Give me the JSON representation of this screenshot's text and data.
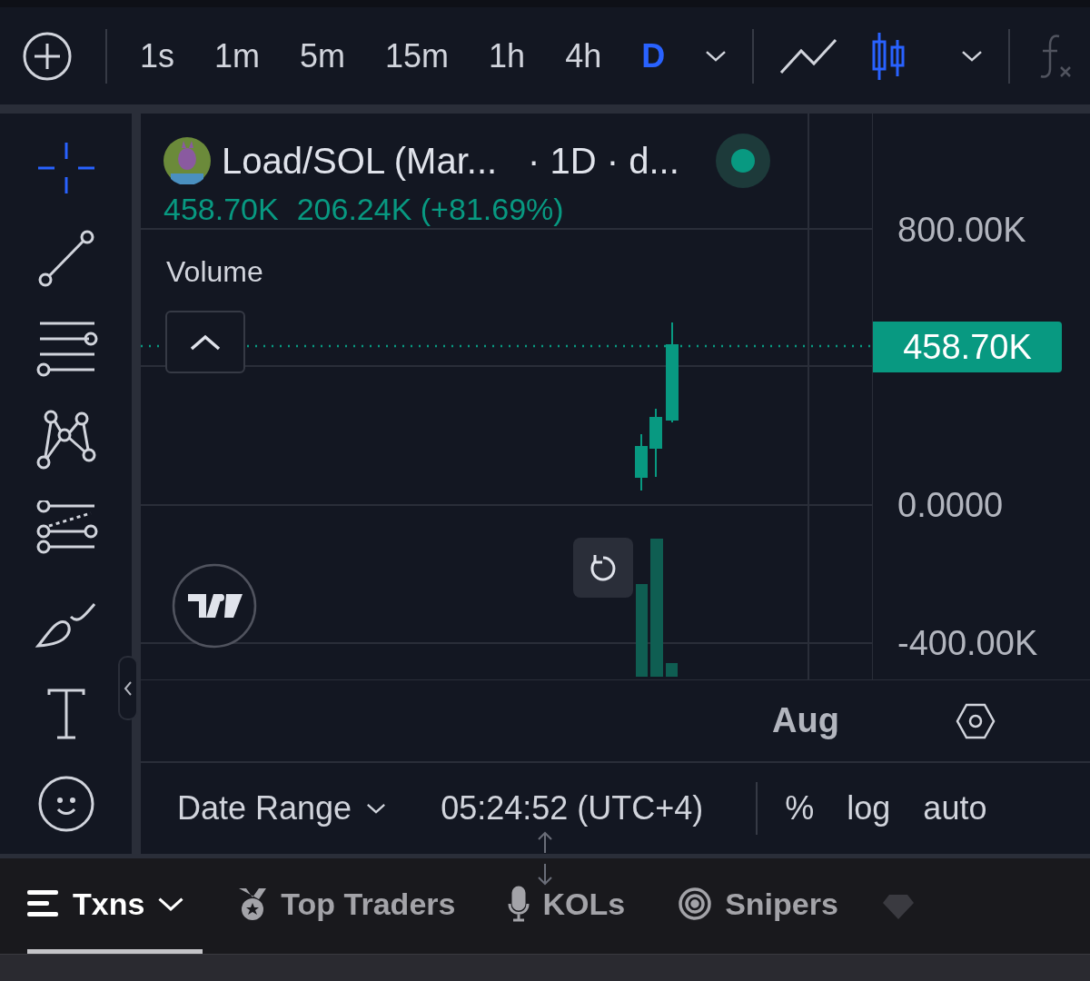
{
  "toolbar": {
    "intervals": [
      {
        "label": "1s",
        "selected": false
      },
      {
        "label": "1m",
        "selected": false
      },
      {
        "label": "5m",
        "selected": false
      },
      {
        "label": "15m",
        "selected": false
      },
      {
        "label": "1h",
        "selected": false
      },
      {
        "label": "4h",
        "selected": false
      },
      {
        "label": "D",
        "selected": true
      }
    ],
    "chart_types": [
      {
        "kind": "line",
        "selected": false
      },
      {
        "kind": "candles",
        "selected": true
      }
    ]
  },
  "drawing_tools": [
    {
      "kind": "crosshair",
      "selected": true
    },
    {
      "kind": "trend-line",
      "selected": false
    },
    {
      "kind": "fib",
      "selected": false
    },
    {
      "kind": "pattern",
      "selected": false
    },
    {
      "kind": "forecast",
      "selected": false
    },
    {
      "kind": "brush",
      "selected": false
    },
    {
      "kind": "text",
      "selected": false
    },
    {
      "kind": "emoji",
      "selected": false
    }
  ],
  "legend": {
    "symbol": "Load/SOL (Mar...",
    "details": "· 1D · d...",
    "live": true,
    "close": "458.70K",
    "change": "206.24K (+81.69%)",
    "indicator": "Volume"
  },
  "price_axis": {
    "labels": [
      "800.00K",
      "0.0000",
      "-400.00K"
    ],
    "last_price": "458.70K"
  },
  "time_axis": {
    "label": "Aug"
  },
  "bottom_bar": {
    "date_range": "Date Range",
    "time": "05:24:52 (UTC+4)",
    "percent": "%",
    "log": "log",
    "auto": "auto"
  },
  "tabs": [
    {
      "label": "Txns",
      "kind": "list",
      "selected": true
    },
    {
      "label": "Top Traders",
      "kind": "medal",
      "selected": false
    },
    {
      "label": "KOLs",
      "kind": "mic",
      "selected": false
    },
    {
      "label": "Snipers",
      "kind": "target",
      "selected": false
    }
  ]
}
